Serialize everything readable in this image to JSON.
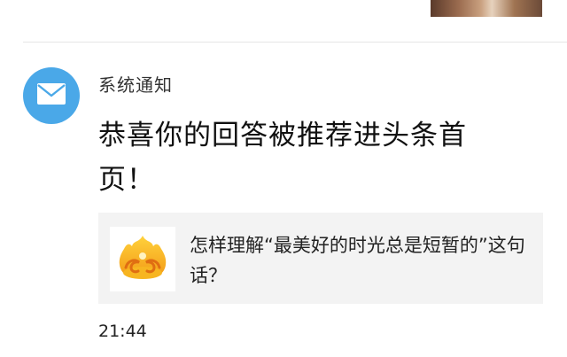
{
  "notification": {
    "sender": "系统通知",
    "headline": "恭喜你的回答被推荐进头条首页！",
    "card": {
      "question": "怎样理解“最美好的时光总是短暂的”这句话？"
    },
    "time": "21:44",
    "icons": {
      "avatar": "envelope-icon",
      "card_thumb": "golden-fire-logo-icon"
    }
  },
  "colors": {
    "avatar_bg": "#4aa8e8",
    "card_bg": "#f3f3f3"
  }
}
